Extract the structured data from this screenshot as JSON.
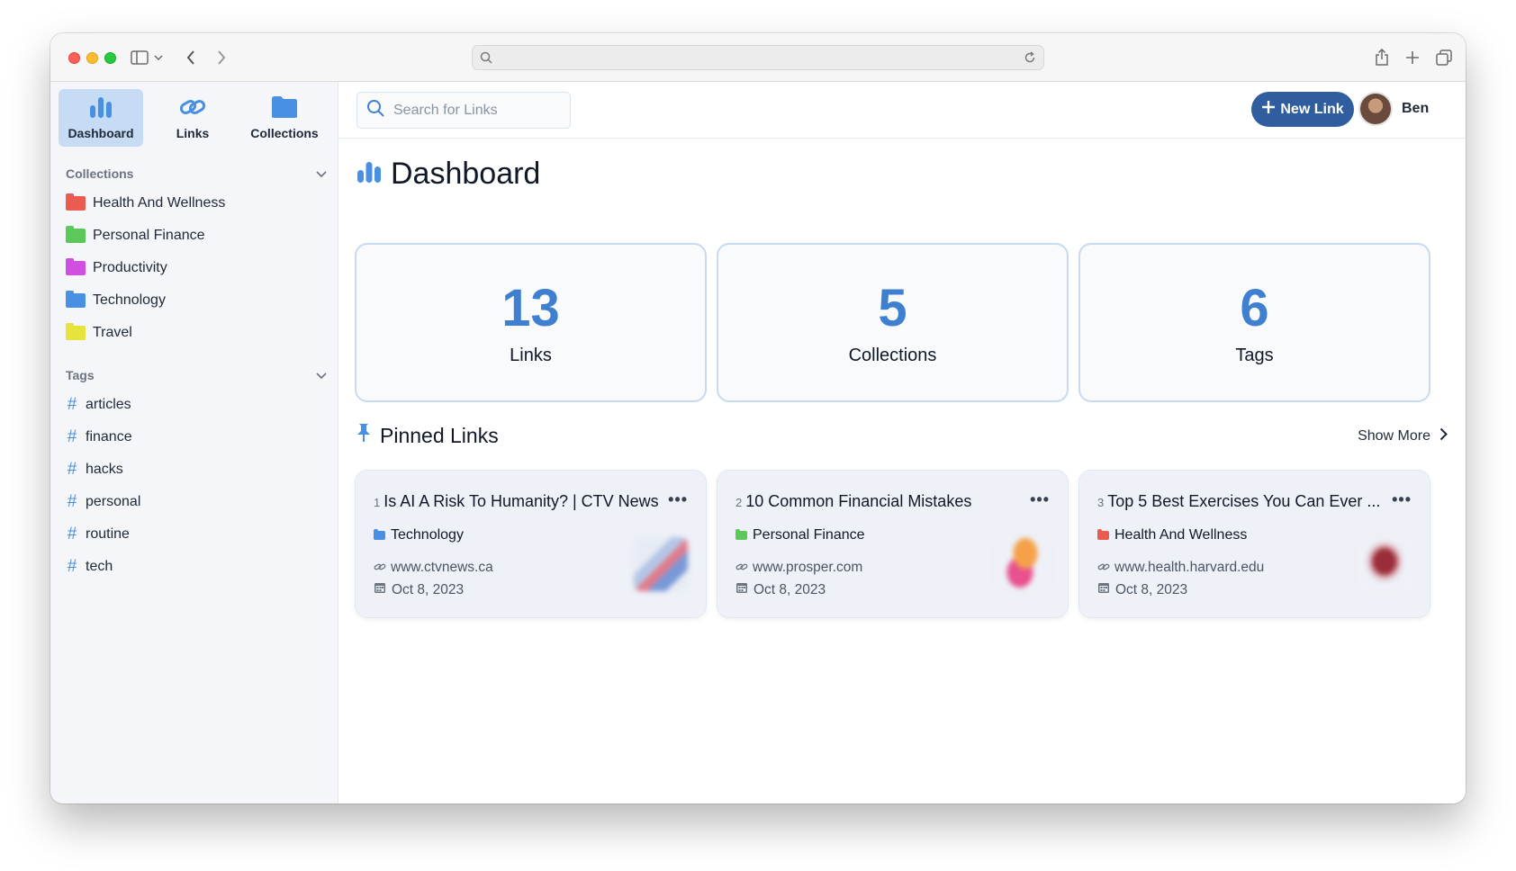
{
  "browser": {
    "address_value": ""
  },
  "sidebar": {
    "nav": [
      {
        "label": "Dashboard",
        "icon": "bar-chart-icon",
        "active": true
      },
      {
        "label": "Links",
        "icon": "link-icon",
        "active": false
      },
      {
        "label": "Collections",
        "icon": "folder-icon",
        "active": false
      }
    ],
    "collections_heading": "Collections",
    "collections": [
      {
        "label": "Health And Wellness",
        "color": "#ec5b4f"
      },
      {
        "label": "Personal Finance",
        "color": "#5bc85a"
      },
      {
        "label": "Productivity",
        "color": "#d04fe0"
      },
      {
        "label": "Technology",
        "color": "#4a90e2"
      },
      {
        "label": "Travel",
        "color": "#e6e33d"
      }
    ],
    "tags_heading": "Tags",
    "tags": [
      "articles",
      "finance",
      "hacks",
      "personal",
      "routine",
      "tech"
    ]
  },
  "topbar": {
    "search_placeholder": "Search for Links",
    "new_link_label": "New Link",
    "user_name": "Ben"
  },
  "main": {
    "title": "Dashboard",
    "stats": [
      {
        "value": "13",
        "label": "Links"
      },
      {
        "value": "5",
        "label": "Collections"
      },
      {
        "value": "6",
        "label": "Tags"
      }
    ],
    "pinned_heading": "Pinned Links",
    "show_more": "Show More",
    "pinned": [
      {
        "index": "1",
        "title": "Is AI A Risk To Humanity? | CTV News",
        "collection": "Technology",
        "collection_color": "#4a90e2",
        "url": "www.ctvnews.ca",
        "date": "Oct 8, 2023"
      },
      {
        "index": "2",
        "title": "10 Common Financial Mistakes",
        "collection": "Personal Finance",
        "collection_color": "#5bc85a",
        "url": "www.prosper.com",
        "date": "Oct 8, 2023"
      },
      {
        "index": "3",
        "title": "Top 5 Best Exercises You Can Ever ...",
        "collection": "Health And Wellness",
        "collection_color": "#ec5b4f",
        "url": "www.health.harvard.edu",
        "date": "Oct 8, 2023"
      }
    ]
  },
  "colors": {
    "accent": "#3f7fd0",
    "button": "#2f5d9d",
    "sidebar_bg": "#f4f6fa"
  }
}
